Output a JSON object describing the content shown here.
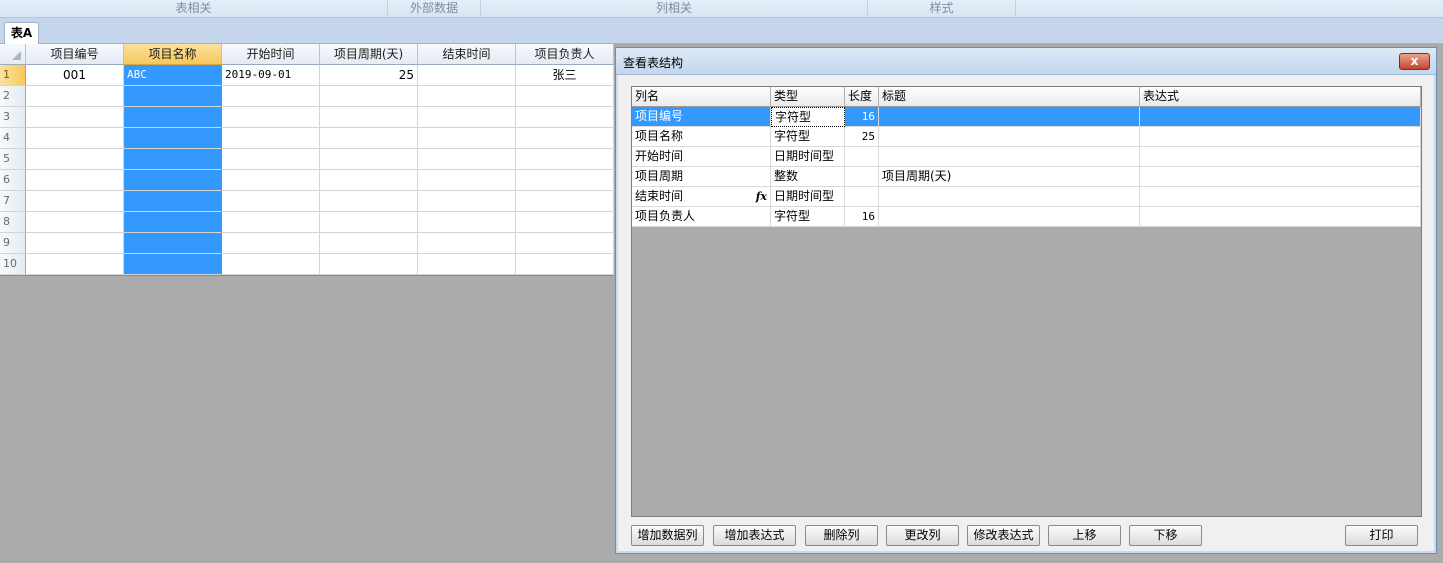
{
  "ribbon": {
    "groups": [
      "表相关",
      "外部数据",
      "列相关",
      "样式"
    ]
  },
  "sheet_tab": "表A",
  "grid": {
    "columns": [
      "项目编号",
      "项目名称",
      "开始时间",
      "项目周期(天)",
      "结束时间",
      "项目负责人"
    ],
    "selected_column": "项目名称",
    "row_numbers": [
      "1",
      "2",
      "3",
      "4",
      "5",
      "6",
      "7",
      "8",
      "9",
      "10"
    ],
    "rows": [
      [
        "001",
        "ABC",
        "2019-09-01",
        "25",
        "",
        "张三"
      ]
    ]
  },
  "dialog": {
    "title": "查看表结构",
    "close_label": "x",
    "columns": [
      "列名",
      "类型",
      "长度",
      "标题",
      "表达式"
    ],
    "rows": [
      {
        "name": "项目编号",
        "type": "字符型",
        "length": "16",
        "caption": "",
        "expr": "",
        "fx": ""
      },
      {
        "name": "项目名称",
        "type": "字符型",
        "length": "25",
        "caption": "",
        "expr": "",
        "fx": ""
      },
      {
        "name": "开始时间",
        "type": "日期时间型",
        "length": "",
        "caption": "",
        "expr": "",
        "fx": ""
      },
      {
        "name": "项目周期",
        "type": "整数",
        "length": "",
        "caption": "项目周期(天)",
        "expr": "",
        "fx": ""
      },
      {
        "name": "结束时间",
        "type": "日期时间型",
        "length": "",
        "caption": "",
        "expr": "",
        "fx": "fx"
      },
      {
        "name": "项目负责人",
        "type": "字符型",
        "length": "16",
        "caption": "",
        "expr": "",
        "fx": ""
      }
    ],
    "buttons": {
      "add_data_column": "增加数据列",
      "add_expression": "增加表达式",
      "delete_column": "删除列",
      "modify_column": "更改列",
      "modify_expression": "修改表达式",
      "move_up": "上移",
      "move_down": "下移",
      "print": "打印"
    }
  },
  "colors": {
    "selection": "#3399ff",
    "active_header": "#f5c85a",
    "workspace": "#ababab"
  }
}
